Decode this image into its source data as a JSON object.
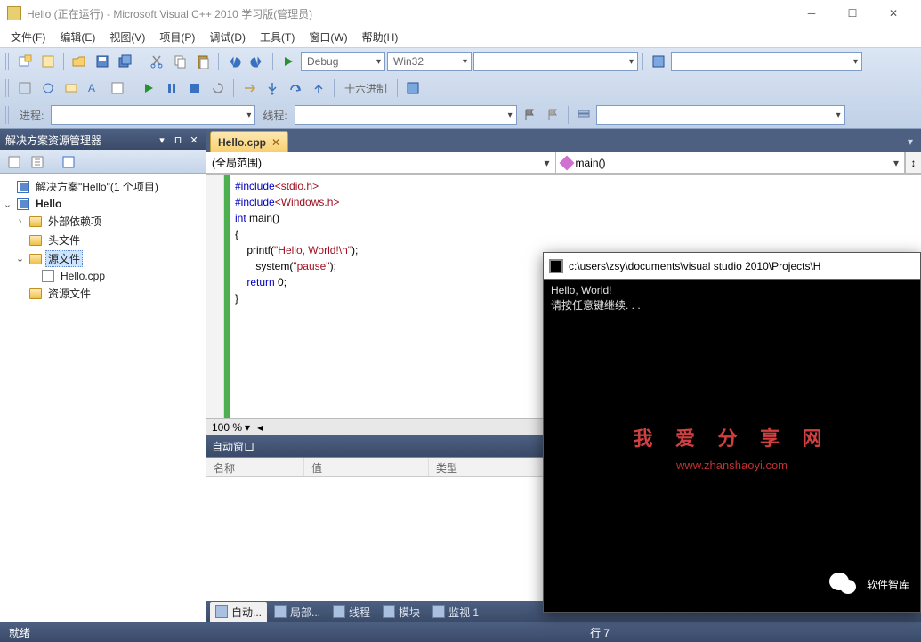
{
  "window": {
    "title": "Hello (正在运行) - Microsoft Visual C++ 2010 学习版(管理员)"
  },
  "menu": {
    "items": [
      "文件(F)",
      "编辑(E)",
      "视图(V)",
      "项目(P)",
      "调试(D)",
      "工具(T)",
      "窗口(W)",
      "帮助(H)"
    ]
  },
  "toolbar1": {
    "config_combo": "Debug",
    "platform_combo": "Win32"
  },
  "toolbar2": {
    "hex_label": "十六进制"
  },
  "toolbar3": {
    "process_label": "进程:",
    "thread_label": "线程:"
  },
  "solution_explorer": {
    "title": "解决方案资源管理器",
    "root": "解决方案\"Hello\"(1 个项目)",
    "project": "Hello",
    "folders": {
      "external": "外部依赖项",
      "headers": "头文件",
      "sources": "源文件",
      "resources": "资源文件"
    },
    "file": "Hello.cpp"
  },
  "editor": {
    "tab": "Hello.cpp",
    "scope": "(全局范围)",
    "method": "main()",
    "zoom": "100 %",
    "code": {
      "l1a": "#include",
      "l1b": "<stdio.h>",
      "l2a": "#include",
      "l2b": "<Windows.h>",
      "l3a": "int",
      "l3b": " main()",
      "l4": "{",
      "l5a": "    printf(",
      "l5b": "\"Hello, World!\\n\"",
      "l5c": ");",
      "l6a": "       system(",
      "l6b": "\"pause\"",
      "l6c": ");",
      "l7a": "    ",
      "l7b": "return",
      "l7c": " 0;",
      "l8": "}"
    }
  },
  "auto_window": {
    "title": "自动窗口",
    "cols": {
      "name": "名称",
      "value": "值",
      "type": "类型"
    }
  },
  "bottom_tabs": {
    "auto": "自动...",
    "locals": "局部...",
    "threads": "线程",
    "modules": "模块",
    "watch": "监视 1"
  },
  "status": {
    "ready": "就绪",
    "line": "行 7"
  },
  "console": {
    "title": "c:\\users\\zsy\\documents\\visual studio 2010\\Projects\\H",
    "line1": "Hello, World!",
    "line2": "请按任意键继续. . ."
  },
  "watermark": {
    "text1": "我 爱 分 享 网",
    "text2": "www.zhanshaoyi.com",
    "text3": "软件智库"
  }
}
